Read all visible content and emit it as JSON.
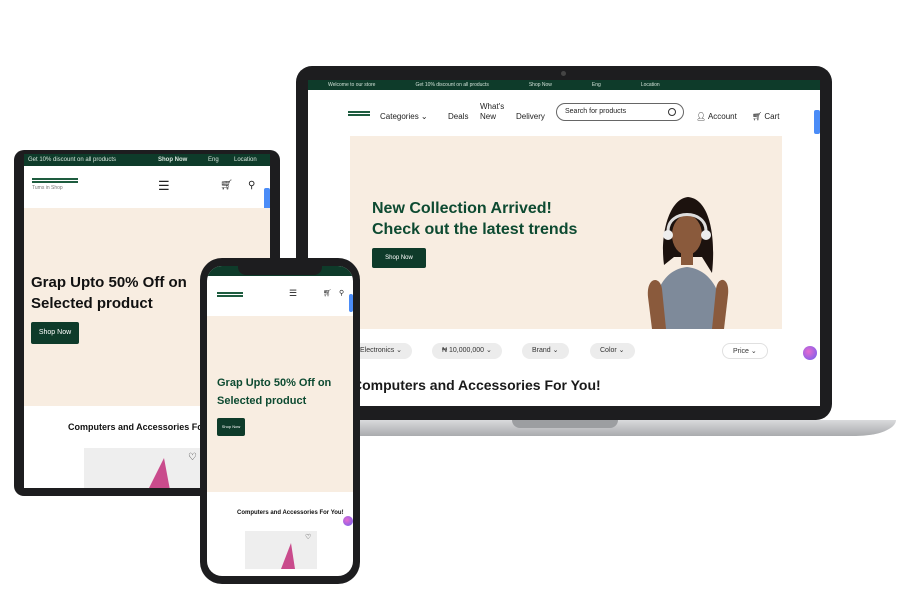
{
  "laptop": {
    "topbar": {
      "welcome": "Welcome to our store",
      "promo": "Get 10% discount on all products",
      "shop_now": "Shop Now",
      "language": "Eng",
      "location": "Location"
    },
    "nav": {
      "categories": "Categories",
      "deals": "Deals",
      "whats_new": "What's New",
      "delivery": "Delivery",
      "search_placeholder": "Search for products",
      "account": "Account",
      "cart": "Cart"
    },
    "hero": {
      "title_line1": "New Collection Arrived!",
      "title_line2": "Check out the latest trends",
      "button": "Shop Now"
    },
    "filters": {
      "category": "Electronics",
      "price_range": "₦ 10,000,000",
      "brand": "Brand",
      "color": "Color",
      "sort": "Price"
    },
    "section_heading": "Computers and Accessories For You!"
  },
  "tablet": {
    "topbar": {
      "promo": "Get 10% discount on all products",
      "shop_now": "Shop Now",
      "language": "Eng",
      "location": "Location"
    },
    "logo_text": "Tums in Shop",
    "hero": {
      "title_line1": "Grap Upto 50% Off on",
      "title_line2": "Selected product",
      "button": "Shop Now"
    },
    "section_heading": "Computers and Accessories For You!"
  },
  "phone": {
    "hero": {
      "title_line1": "Grap Upto 50% Off on",
      "title_line2": "Selected product",
      "button": "Shop Now"
    },
    "section_heading": "Computers and Accessories For You!"
  },
  "colors": {
    "brand_green": "#0e3b2a",
    "hero_bg": "#f8ede1",
    "accent_blue": "#4b8cf7"
  }
}
